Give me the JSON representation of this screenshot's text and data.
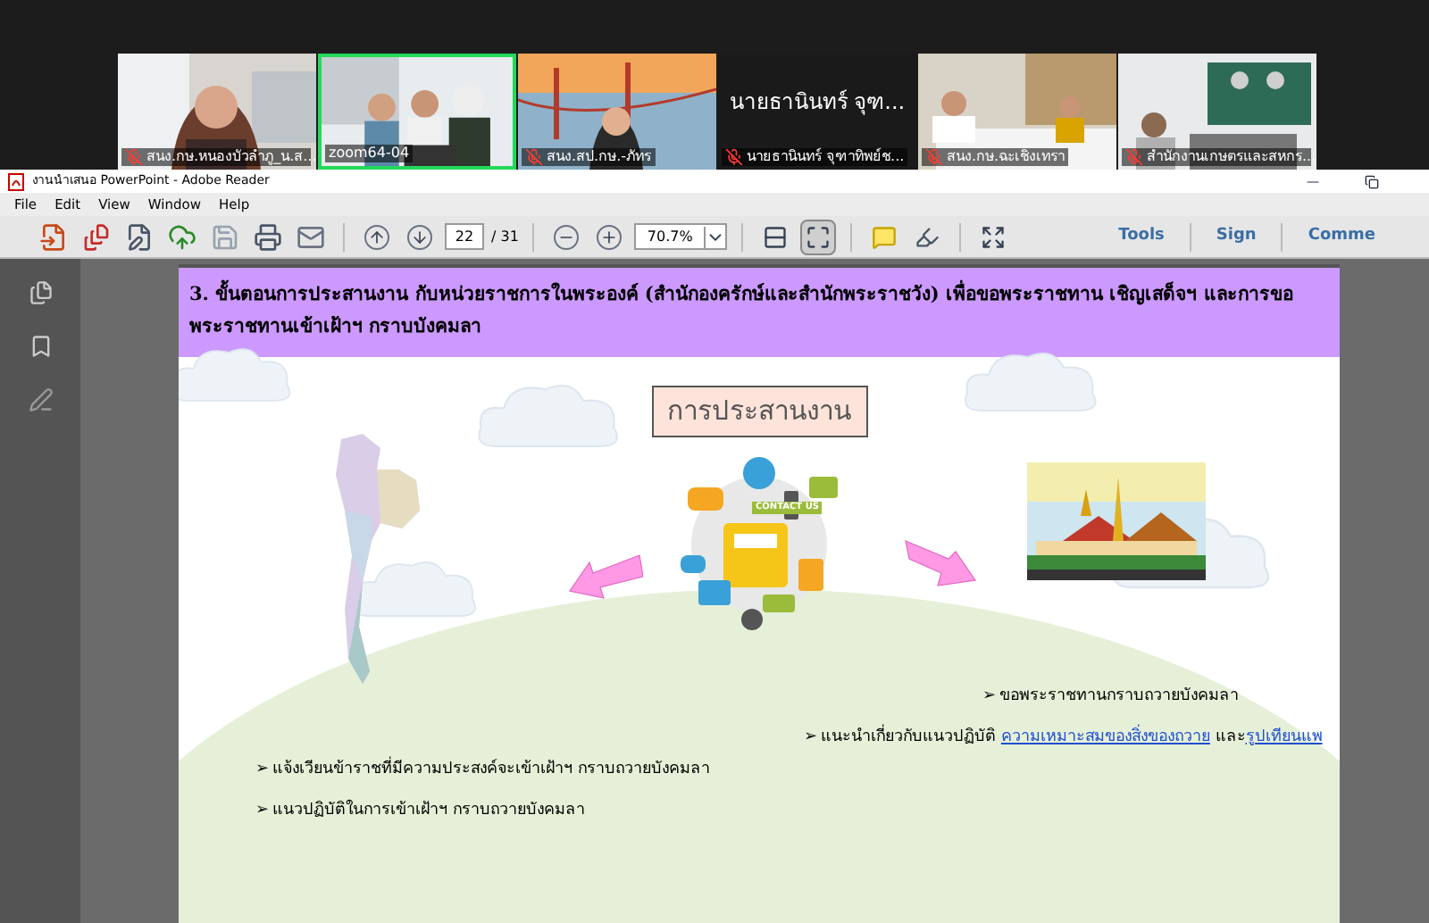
{
  "participants": [
    {
      "kind": "video",
      "name": "สนง.กษ.หนองบัวลำภู_น.ส...",
      "muted": true,
      "selected": false
    },
    {
      "kind": "video",
      "name": "zoom64-04",
      "muted": false,
      "selected": true
    },
    {
      "kind": "video",
      "name": "สนง.สป.กษ.-ภัทร",
      "muted": true,
      "selected": false
    },
    {
      "kind": "name",
      "display_name": "นายธานินทร์ จุฑ...",
      "name": "นายธานินทร์ จุฑาทิพย์ช...",
      "muted": true,
      "selected": false
    },
    {
      "kind": "video",
      "name": "สนง.กษ.ฉะเชิงเทรา",
      "muted": true,
      "selected": false
    },
    {
      "kind": "video",
      "name": "สำนักงานเกษตรและสหกร...",
      "muted": true,
      "selected": false
    }
  ],
  "window": {
    "title": "งานนำเสนอ PowerPoint - Adobe Reader"
  },
  "menu": [
    "File",
    "Edit",
    "View",
    "Window",
    "Help"
  ],
  "toolbar": {
    "page": "22",
    "page_total": "/ 31",
    "zoom": "70.7%",
    "fit_page_selected": false,
    "fit_width_selected": true,
    "panels": [
      {
        "label": "Tools"
      },
      {
        "label": "Sign"
      },
      {
        "label": "Comme"
      }
    ]
  },
  "slide": {
    "title": "3. ขั้นตอนการประสานงาน กับหน่วยราชการในพระองค์ (สำนักองครักษ์และสำนักพระราชวัง) เพื่อขอพระราชทาน เชิญเสด็จฯ และการขอพระราชทานเข้าเฝ้าฯ กราบบังคมลา",
    "center_label": "การประสานงาน",
    "contact_label": "CONTACT US",
    "right_bullets": [
      {
        "marker": "➢",
        "text": "ขอพระราชทานกราบถวายบังคมลา"
      },
      {
        "marker": "➢",
        "text": "แนะนำเกี่ยวกับแนวปฏิบัติ ",
        "links": [
          "ความเหมาะสมของสิ่งของถวาย"
        ],
        "joiner": " และ",
        "link2": "รูปเทียนแพ"
      }
    ],
    "left_bullets": [
      {
        "marker": "➢",
        "text": "แจ้งเวียนข้าราชที่มีความประสงค์จะเข้าเฝ้าฯ กราบถวายบังคมลา"
      },
      {
        "marker": "➢",
        "text": "แนวปฏิบัติในการเข้าเฝ้าฯ กราบถวายบังคมลา"
      }
    ]
  }
}
